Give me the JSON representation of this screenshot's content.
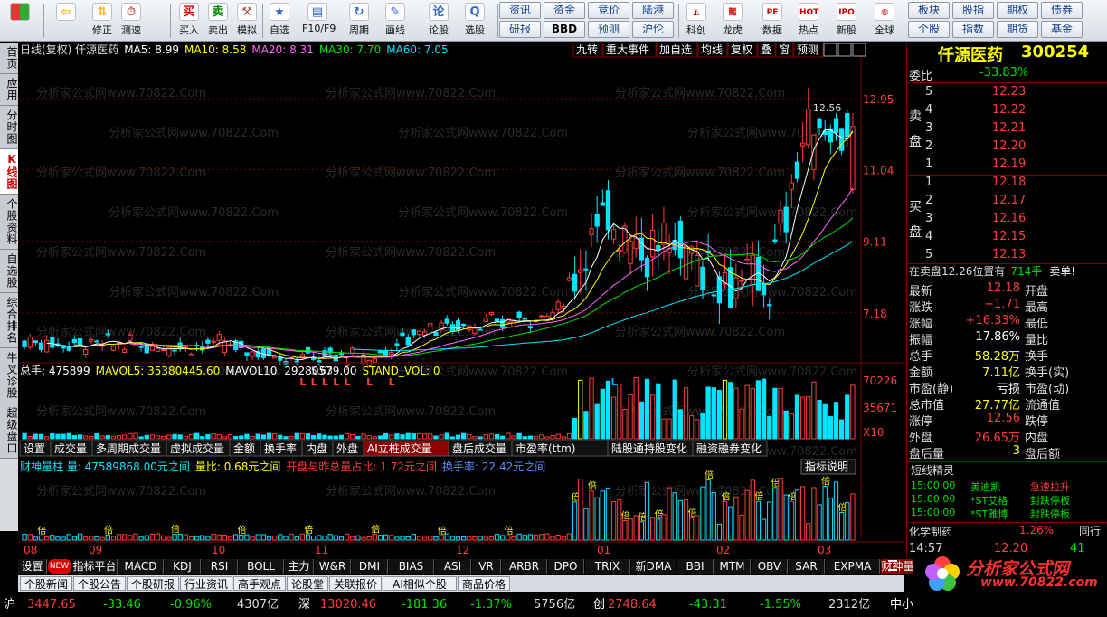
{
  "toolbar": {
    "left": [
      {
        "icon": "grid-icon",
        "label": ""
      },
      {
        "icon": "back-arrow-icon",
        "label": ""
      },
      {
        "icon": "up-down-icon",
        "label": "修正"
      },
      {
        "icon": "clock-icon",
        "label": "测速"
      },
      {
        "icon": "buy-icon",
        "label": "买入"
      },
      {
        "icon": "sell-icon",
        "label": "卖出"
      },
      {
        "icon": "gavel-icon",
        "label": "模拟"
      },
      {
        "icon": "star-icon",
        "label": "自选"
      },
      {
        "icon": "f10-icon",
        "label": "F10/F9"
      },
      {
        "icon": "cycle-icon",
        "label": "周期"
      },
      {
        "icon": "pencil-icon",
        "label": "画线"
      },
      {
        "icon": "stock-discuss-icon",
        "label": "论股"
      },
      {
        "icon": "search-select-icon",
        "label": "选股"
      }
    ],
    "left_glyphs": [
      "",
      "⇦",
      "⇅",
      "⏱",
      "买",
      "卖",
      "⚒",
      "★",
      "▤",
      "↻",
      "✎",
      "论",
      "Q"
    ],
    "grid_buttons": [
      [
        "资讯",
        "资金",
        "竞价",
        "陆港"
      ],
      [
        "研报",
        "BBD",
        "预测",
        "沪伦"
      ]
    ],
    "right": [
      {
        "icon": "chart-icon",
        "label": "科创",
        "glyph": "◭"
      },
      {
        "icon": "dragon-icon",
        "label": "龙虎",
        "glyph": "龍"
      },
      {
        "icon": "pe-icon",
        "label": "数据",
        "glyph": "PE"
      },
      {
        "icon": "hot-icon",
        "label": "热点",
        "glyph": "HOT"
      },
      {
        "icon": "ipo-icon",
        "label": "新股",
        "glyph": "IPO"
      },
      {
        "icon": "globe-icon",
        "label": "全球",
        "glyph": "◍"
      }
    ],
    "right_buttons": [
      [
        "板块",
        "股指",
        "期权",
        "债券"
      ],
      [
        "个股",
        "指数",
        "期货",
        "基金"
      ]
    ]
  },
  "left_tabs": [
    "首页",
    "应用",
    "分时图",
    "K线图",
    "个股资料",
    "自选股",
    "综合排名",
    "牛叉诊股",
    "超级盘口"
  ],
  "chart": {
    "header": "日线(复权)  仟源医药",
    "ma": [
      {
        "label": "MA5: 8.99",
        "color": "#ffffff"
      },
      {
        "label": "MA10: 8.58",
        "color": "#ffff00"
      },
      {
        "label": "MA20: 8.31",
        "color": "#ff66ff"
      },
      {
        "label": "MA30: 7.70",
        "color": "#00e000"
      },
      {
        "label": "MA60: 7.05",
        "color": "#00e5ff"
      }
    ],
    "top_buttons": [
      "九转",
      "重大事件",
      "加自选",
      "均线",
      "复权",
      "叠",
      "窗",
      "预测"
    ],
    "price_axis": [
      "12.95",
      "11.04",
      "9.11",
      "7.18"
    ],
    "high_label": "12.56",
    "low_label": "5.63",
    "watermark": "分析家公式网www.70822.Com",
    "vol_header": [
      {
        "label": "总手: 475899",
        "color": "#ffffff"
      },
      {
        "label": "MAVOL5: 35380445.60",
        "color": "#ffff00"
      },
      {
        "label": "MAVOL10: 29280579.00",
        "color": "#ffffff"
      },
      {
        "label": "STAND_VOL: 0",
        "color": "#ffff00"
      }
    ],
    "vol_axis": [
      "70226",
      "35671",
      "X10"
    ],
    "sub_tabs": [
      "设置",
      "成交量",
      "多周期成交量",
      "虚拟成交量",
      "金额",
      "换手率",
      "内盘",
      "外盘",
      "AI立桩成交量",
      "盘后成交量",
      "市盈率(ttm)",
      "陆股通持股变化",
      "融资融券变化"
    ],
    "mf_header": [
      {
        "label": "财神量柱 量: 47589868.00元之间",
        "color": "#00e5ff"
      },
      {
        "label": "量比: 0.68元之间",
        "color": "#ffff00"
      },
      {
        "label": "开盘与昨总量占比: 1.72元之间",
        "color": "#ff3c3c"
      },
      {
        "label": "换手率: 22.42元之间",
        "color": "#5b8cff"
      }
    ],
    "indicator_btn": "指标说明",
    "mf_marker": "倍",
    "x_axis": [
      "08",
      "09",
      "10",
      "11",
      "12",
      "01",
      "02",
      "03"
    ],
    "signal_chars": "L"
  },
  "chart_data": {
    "type": "candlestick",
    "x_labels": [
      "08",
      "09",
      "10",
      "11",
      "12",
      "01",
      "02",
      "03"
    ],
    "price_axis": [
      7.18,
      9.11,
      11.04,
      12.95
    ],
    "high": 12.56,
    "low": 5.63,
    "ma": {
      "MA5": 8.99,
      "MA10": 8.58,
      "MA20": 8.31,
      "MA30": 7.7,
      "MA60": 7.05
    }
  },
  "quote": {
    "name": "仟源医药",
    "code": "300254",
    "webi_label": "委比",
    "webi": "-33.83%",
    "sell_label": "卖盘",
    "buy_label": "买盘",
    "asks": [
      {
        "n": "5",
        "p": "12.23"
      },
      {
        "n": "4",
        "p": "12.22"
      },
      {
        "n": "3",
        "p": "12.21"
      },
      {
        "n": "2",
        "p": "12.20"
      },
      {
        "n": "1",
        "p": "12.19"
      }
    ],
    "bids": [
      {
        "n": "1",
        "p": "12.18"
      },
      {
        "n": "2",
        "p": "12.17"
      },
      {
        "n": "3",
        "p": "12.16"
      },
      {
        "n": "4",
        "p": "12.15"
      },
      {
        "n": "5",
        "p": "12.13"
      }
    ],
    "pending": "在卖盘12.26位置有",
    "pending_vol": "714手",
    "pending_tag": "卖单!",
    "rows": [
      {
        "k1": "最新",
        "v1": "12.18",
        "c1": "red",
        "k2": "开盘",
        "v2": ""
      },
      {
        "k1": "涨跌",
        "v1": "+1.71",
        "c1": "red",
        "k2": "最高",
        "v2": ""
      },
      {
        "k1": "涨幅",
        "v1": "+16.33%",
        "c1": "red",
        "k2": "最低",
        "v2": ""
      },
      {
        "k1": "振幅",
        "v1": "17.86%",
        "c1": "wht",
        "k2": "量比",
        "v2": ""
      },
      {
        "k1": "总手",
        "v1": "58.28万",
        "c1": "yel",
        "k2": "换手",
        "v2": ""
      },
      {
        "k1": "金额",
        "v1": "7.11亿",
        "c1": "yel",
        "k2": "换手(实)",
        "v2": ""
      },
      {
        "k1": "市盈(静)",
        "v1": "亏损",
        "c1": "wht",
        "k2": "市盈(动)",
        "v2": ""
      },
      {
        "k1": "总市值",
        "v1": "27.77亿",
        "c1": "yel",
        "k2": "流通值",
        "v2": ""
      },
      {
        "k1": "涨停",
        "v1": "12.56",
        "c1": "red",
        "k2": "跌停",
        "v2": ""
      },
      {
        "k1": "外盘",
        "v1": "26.65万",
        "c1": "red",
        "k2": "内盘",
        "v2": ""
      },
      {
        "k1": "盘后量",
        "v1": "3",
        "c1": "yel",
        "k2": "盘后额",
        "v2": ""
      }
    ],
    "sprite_title": "短线精灵",
    "sprite": [
      {
        "t": "15:00:00",
        "n": "美迪凯",
        "s": "急速拉升"
      },
      {
        "t": "15:00:00",
        "n": "*ST艾格",
        "s": "封跌停板"
      },
      {
        "t": "15:00:00",
        "n": "*ST雅博",
        "s": "封跌停板"
      }
    ],
    "sector": "化学制药",
    "sector_chg": "1.26%",
    "sector_btn": "同行",
    "tick_time": "14:57",
    "tick_price": "12.20",
    "tick_vol": "41"
  },
  "bottom_tabs": [
    "设置",
    "NEW",
    "指标平台",
    "MACD",
    "KDJ",
    "RSI",
    "BOLL",
    "主力",
    "W&R",
    "DMI",
    "BIAS",
    "ASI",
    "VR",
    "ARBR",
    "DPO",
    "TRIX",
    "新DMA",
    "BBI",
    "MTM",
    "OBV",
    "SAR",
    "EXPMA",
    "财神量柱"
  ],
  "news_tabs": [
    "个股新闻",
    "个股公告",
    "个股研报",
    "行业资讯",
    "高手观点",
    "论股堂",
    "关联报价",
    "AI相似个股",
    "商品价格"
  ],
  "status": {
    "sh_label": "沪",
    "sh_val": "3447.65",
    "sh_chg": "-33.46",
    "sh_pct": "-0.96%",
    "sh_amt": "4307亿",
    "sz_label": "深",
    "sz_val": "13020.46",
    "sz_chg": "-181.36",
    "sz_pct": "-1.37%",
    "sz_amt": "5756亿",
    "cy_label": "创",
    "cy_val": "2748.64",
    "cy_chg": "-43.31",
    "cy_pct": "-1.55%",
    "cy_amt": "2312亿",
    "tail": "中小"
  },
  "brand": {
    "name": "分析家公式网",
    "url": "www.70822.com"
  }
}
